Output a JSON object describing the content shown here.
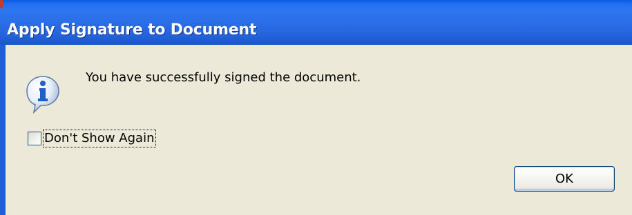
{
  "window": {
    "title": "Apply Signature to Document"
  },
  "dialog": {
    "icon": "info-icon",
    "message": "You have successfully signed the document.",
    "checkbox": {
      "label": "Don't Show Again",
      "checked": false
    },
    "ok_label": "OK"
  },
  "colors": {
    "titlebar": "#2767e0",
    "client_background": "#ece9d8",
    "icon_blue": "#2a6fd6"
  }
}
